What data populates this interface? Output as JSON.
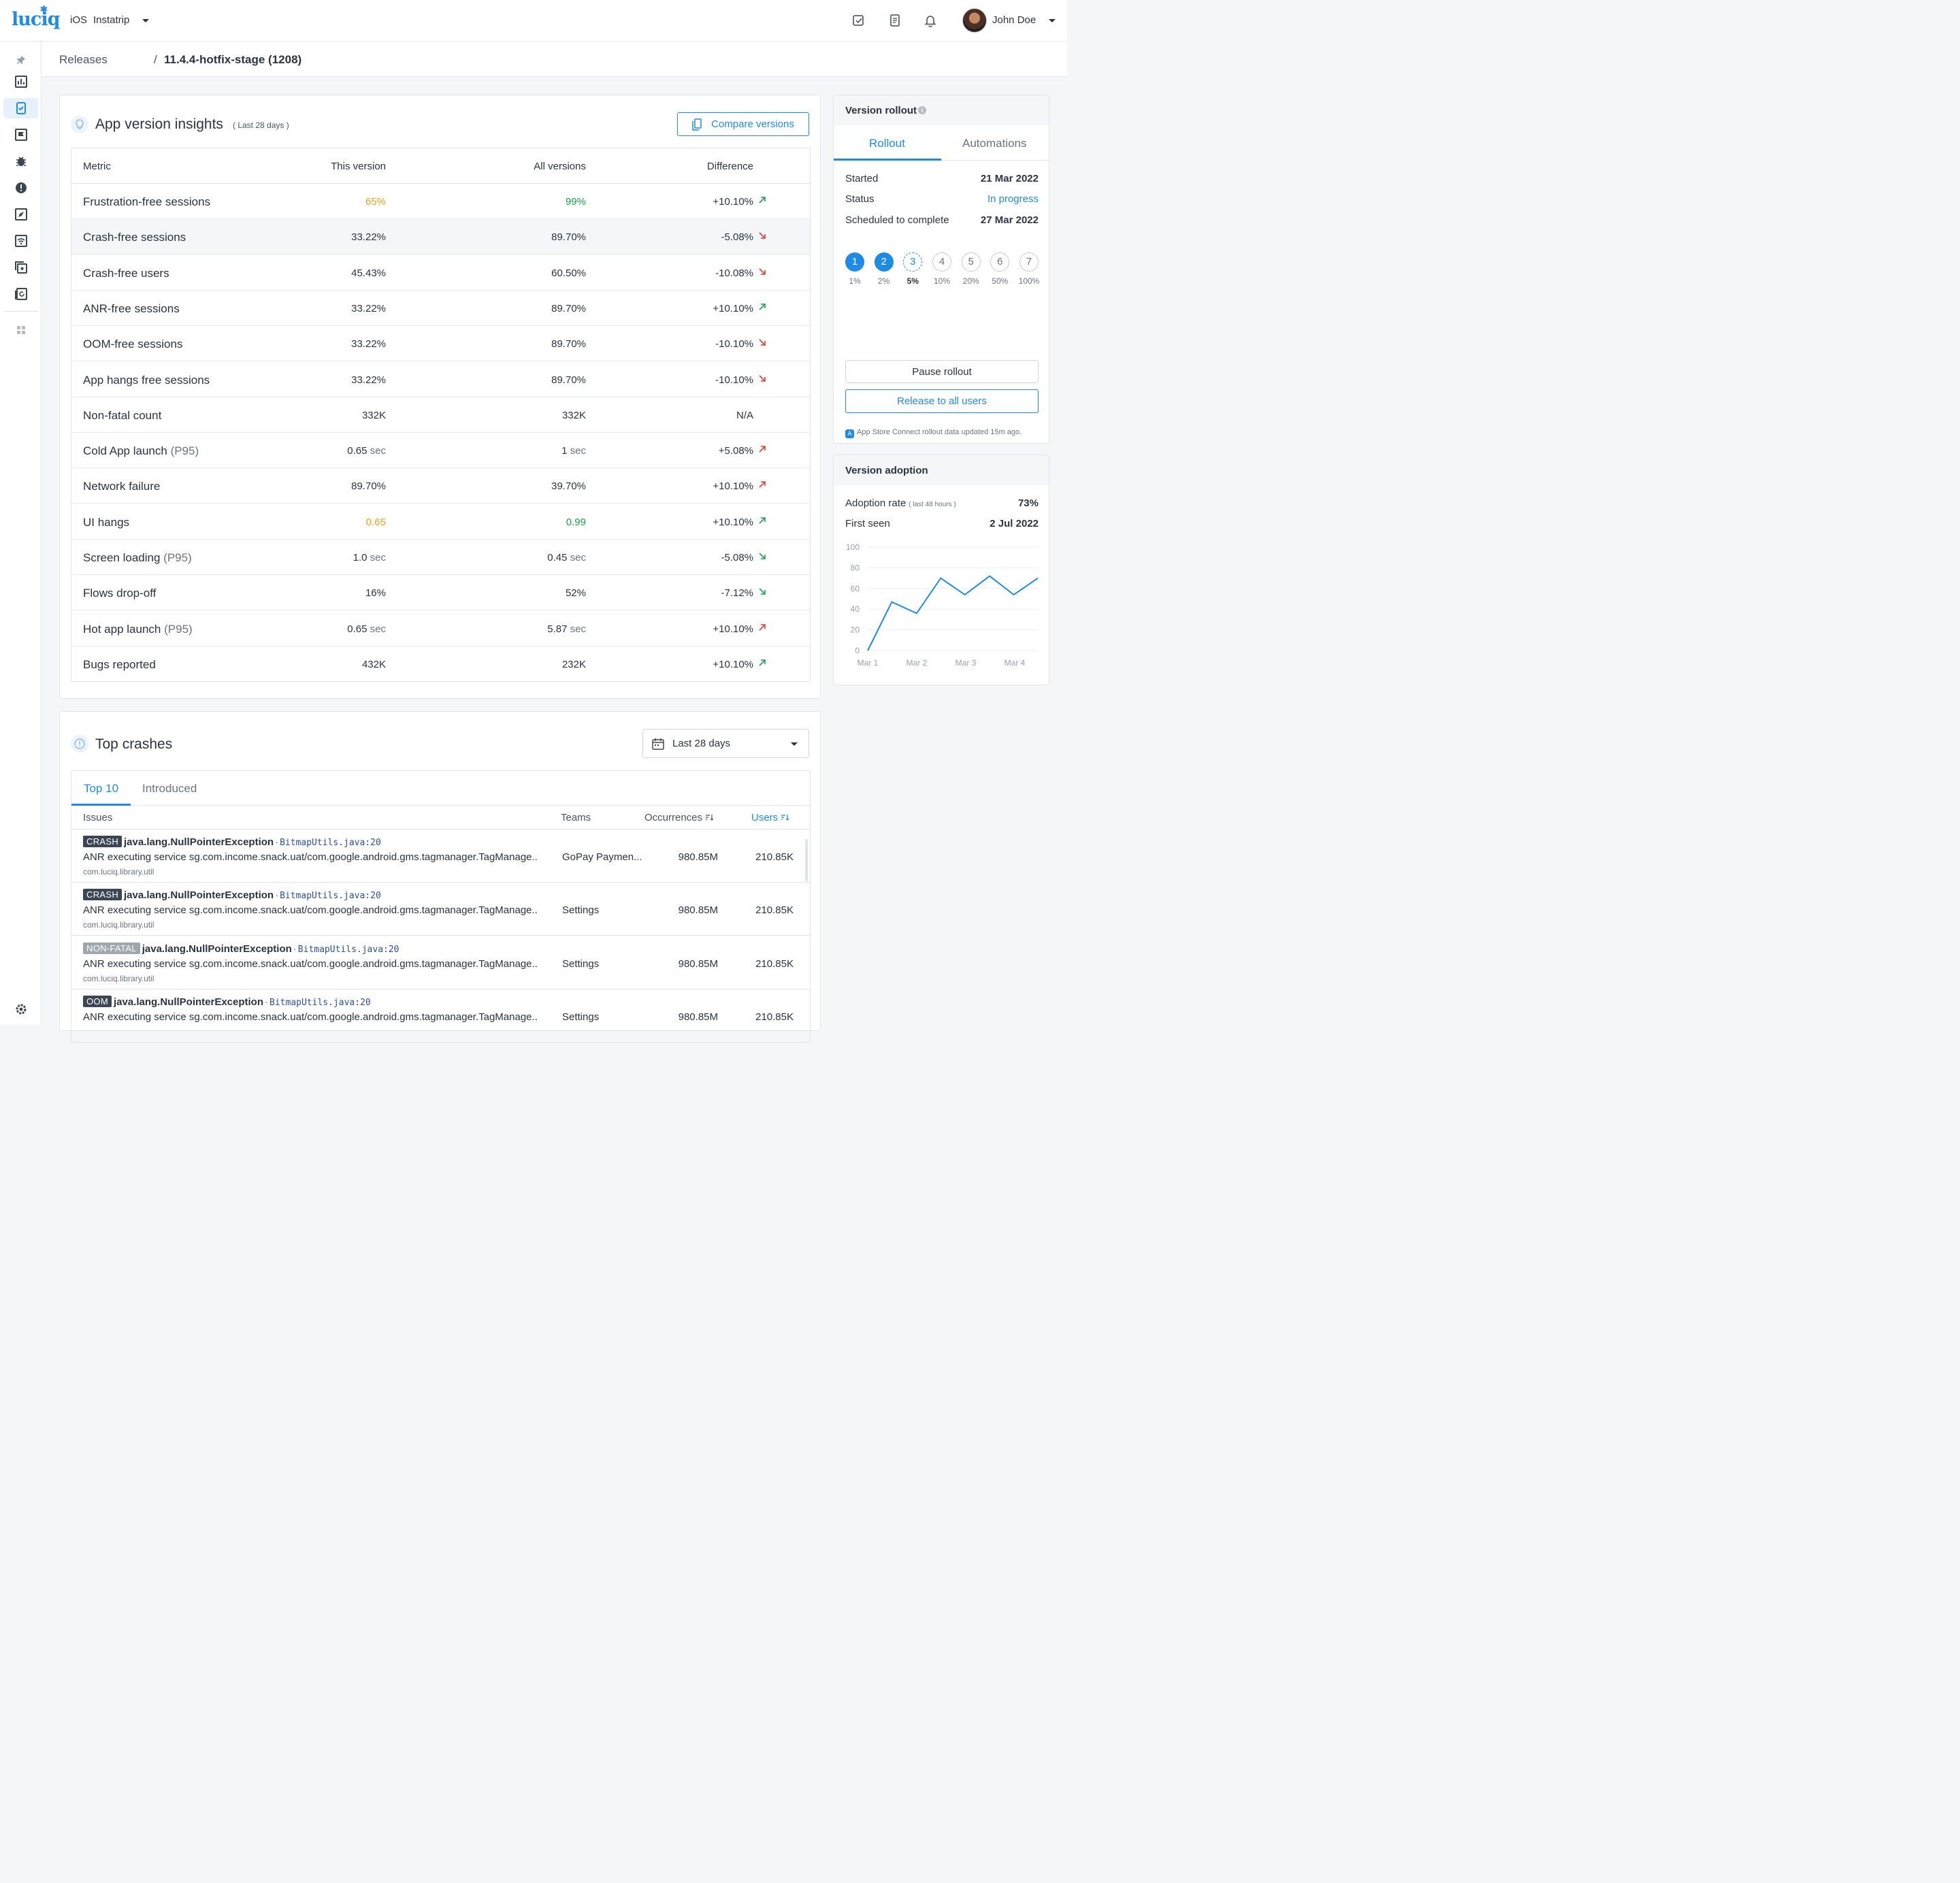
{
  "header": {
    "logo": "luciq",
    "platform": "iOS",
    "app_name": "Instatrip",
    "user_name": "John Doe",
    "icons": [
      "task-check-icon",
      "document-icon",
      "bell-icon"
    ]
  },
  "sidebar": {
    "icons": [
      "pin-icon",
      "dashboard-icon",
      "releases-icon",
      "flag-icon",
      "bug-icon",
      "alert-icon",
      "rocket-icon",
      "network-icon",
      "stack-icon",
      "replay-icon",
      "apps-icon",
      "settings-icon"
    ],
    "active": "releases-icon"
  },
  "breadcrumb": {
    "root": "Releases",
    "separator": "/",
    "current": "11.4.4-hotfix-stage (1208)"
  },
  "insights": {
    "title": "App version insights",
    "subtitle": "( Last 28 days )",
    "compare_label": "Compare versions",
    "columns": {
      "metric": "Metric",
      "this": "This version",
      "all": "All versions",
      "diff": "Difference"
    },
    "rows": [
      {
        "metric": "Frustration-free sessions",
        "suffix": "",
        "this": "65%",
        "this_unit": "",
        "this_color": "#f0a11a",
        "all": "99%",
        "all_unit": "",
        "all_color": "#17a34a",
        "diff": "+10.10%",
        "trend": "up-good"
      },
      {
        "metric": "Crash-free sessions",
        "suffix": "",
        "this": "33.22%",
        "this_unit": "",
        "this_color": "",
        "all": "89.70%",
        "all_unit": "",
        "all_color": "",
        "diff": "-5.08%",
        "trend": "down-bad"
      },
      {
        "metric": "Crash-free users",
        "suffix": "",
        "this": "45.43%",
        "this_unit": "",
        "this_color": "",
        "all": "60.50%",
        "all_unit": "",
        "all_color": "",
        "diff": "-10.08%",
        "trend": "down-bad"
      },
      {
        "metric": "ANR-free sessions",
        "suffix": "",
        "this": "33.22%",
        "this_unit": "",
        "this_color": "",
        "all": "89.70%",
        "all_unit": "",
        "all_color": "",
        "diff": "+10.10%",
        "trend": "up-good"
      },
      {
        "metric": "OOM-free sessions",
        "suffix": "",
        "this": "33.22%",
        "this_unit": "",
        "this_color": "",
        "all": "89.70%",
        "all_unit": "",
        "all_color": "",
        "diff": "-10.10%",
        "trend": "down-bad"
      },
      {
        "metric": "App hangs free sessions",
        "suffix": "",
        "this": "33.22%",
        "this_unit": "",
        "this_color": "",
        "all": "89.70%",
        "all_unit": "",
        "all_color": "",
        "diff": "-10.10%",
        "trend": "down-bad"
      },
      {
        "metric": "Non-fatal count",
        "suffix": "",
        "this": "332K",
        "this_unit": "",
        "this_color": "",
        "all": "332K",
        "all_unit": "",
        "all_color": "",
        "diff": "N/A",
        "trend": "none"
      },
      {
        "metric": "Cold App launch",
        "suffix": "(P95)",
        "this": "0.65",
        "this_unit": "sec",
        "this_color": "",
        "all": "1",
        "all_unit": "sec",
        "all_color": "",
        "diff": "+5.08%",
        "trend": "up-bad"
      },
      {
        "metric": "Network failure",
        "suffix": "",
        "this": "89.70%",
        "this_unit": "",
        "this_color": "",
        "all": "39.70%",
        "all_unit": "",
        "all_color": "",
        "diff": "+10.10%",
        "trend": "up-bad"
      },
      {
        "metric": "UI hangs",
        "suffix": "",
        "this": "0.65",
        "this_unit": "",
        "this_color": "#f0a11a",
        "all": "0.99",
        "all_unit": "",
        "all_color": "#17a34a",
        "diff": "+10.10%",
        "trend": "up-good"
      },
      {
        "metric": "Screen loading",
        "suffix": "(P95)",
        "this": "1.0",
        "this_unit": "sec",
        "this_color": "",
        "all": "0.45",
        "all_unit": "sec",
        "all_color": "",
        "diff": "-5.08%",
        "trend": "down-good"
      },
      {
        "metric": "Flows drop-off",
        "suffix": "",
        "this": "16%",
        "this_unit": "",
        "this_color": "",
        "all": "52%",
        "all_unit": "",
        "all_color": "",
        "diff": "-7.12%",
        "trend": "down-good"
      },
      {
        "metric": "Hot app launch",
        "suffix": "(P95)",
        "this": "0.65",
        "this_unit": "sec",
        "this_color": "",
        "all": "5.87",
        "all_unit": "sec",
        "all_color": "",
        "diff": "+10.10%",
        "trend": "up-bad"
      },
      {
        "metric": "Bugs reported",
        "suffix": "",
        "this": "432K",
        "this_unit": "",
        "this_color": "",
        "all": "232K",
        "all_unit": "",
        "all_color": "",
        "diff": "+10.10%",
        "trend": "up-good"
      }
    ]
  },
  "crashes": {
    "title": "Top crashes",
    "date_range": "Last 28 days",
    "tabs": [
      "Top 10",
      "Introduced"
    ],
    "active_tab": "Top 10",
    "columns": {
      "issues": "Issues",
      "teams": "Teams",
      "occurrences": "Occurrences",
      "users": "Users"
    },
    "rows": [
      {
        "badge": "CRASH",
        "badge_type": "crash",
        "exception": "java.lang.NullPointerException",
        "separator": "·",
        "file": "BitmapUtils.java:20",
        "message": "ANR executing service sg.com.income.snack.uat/com.google.android.gms.tagmanager.TagManage..",
        "package": "com.luciq.library.util",
        "team": "GoPay Paymen...",
        "occurrences": "980.85M",
        "users": "210.85K"
      },
      {
        "badge": "CRASH",
        "badge_type": "crash",
        "exception": "java.lang.NullPointerException",
        "separator": "·",
        "file": "BitmapUtils.java:20",
        "message": "ANR executing service sg.com.income.snack.uat/com.google.android.gms.tagmanager.TagManage..",
        "package": "com.luciq.library.util",
        "team": "Settings",
        "occurrences": "980.85M",
        "users": "210.85K"
      },
      {
        "badge": "NON-FATAL",
        "badge_type": "nonfatal",
        "exception": "java.lang.NullPointerException",
        "separator": "·",
        "file": "BitmapUtils.java:20",
        "message": "ANR executing service sg.com.income.snack.uat/com.google.android.gms.tagmanager.TagManage..",
        "package": "com.luciq.library.util",
        "team": "Settings",
        "occurrences": "980.85M",
        "users": "210.85K"
      },
      {
        "badge": "OOM",
        "badge_type": "crash",
        "exception": "java.lang.NullPointerException",
        "separator": "·",
        "file": "BitmapUtils.java:20",
        "message": "ANR executing service sg.com.income.snack.uat/com.google.android.gms.tagmanager.TagManage..",
        "package": "",
        "team": "Settings",
        "occurrences": "980.85M",
        "users": "210.85K"
      }
    ]
  },
  "rollout": {
    "title": "Version rollout",
    "info_glyph": "i",
    "tabs": [
      "Rollout",
      "Automations"
    ],
    "active_tab": "Rollout",
    "started_label": "Started",
    "started": "21 Mar 2022",
    "status_label": "Status",
    "status": "In progress",
    "scheduled_label": "Scheduled to complete",
    "scheduled": "27 Mar 2022",
    "steps": [
      {
        "n": "1",
        "pct": "1%",
        "state": "done"
      },
      {
        "n": "2",
        "pct": "2%",
        "state": "done"
      },
      {
        "n": "3",
        "pct": "5%",
        "state": "current"
      },
      {
        "n": "4",
        "pct": "10%",
        "state": "pending"
      },
      {
        "n": "5",
        "pct": "20%",
        "state": "pending"
      },
      {
        "n": "6",
        "pct": "50%",
        "state": "pending"
      },
      {
        "n": "7",
        "pct": "100%",
        "state": "pending"
      }
    ],
    "pause_label": "Pause rollout",
    "release_label": "Release to all users",
    "store_note": "App Store Connect rollout data updated 15m ago."
  },
  "adoption": {
    "title": "Version adoption",
    "rate_label": "Adoption rate",
    "rate_note": "( last 48 hours )",
    "rate": "73%",
    "first_seen_label": "First seen",
    "first_seen": "2 Jul 2022"
  },
  "chart_data": {
    "type": "line",
    "x": [
      0,
      0.33,
      0.67,
      1.0,
      1.33,
      1.67,
      2.0,
      2.33,
      2.67,
      3.0,
      3.33
    ],
    "y": [
      0,
      47,
      36,
      70,
      54,
      72,
      54,
      70
    ],
    "categories": [
      "Mar 1",
      "Mar 2",
      "Mar 3",
      "Mar 4"
    ],
    "yticks": [
      "0",
      "20",
      "40",
      "60",
      "80",
      "100"
    ],
    "ylim": [
      0,
      100
    ],
    "color": "#1f8be8",
    "grid": true
  },
  "colors": {
    "accent": "#1f8be8",
    "good": "#17a34a",
    "bad": "#e5392f",
    "warn": "#f0a11a"
  }
}
